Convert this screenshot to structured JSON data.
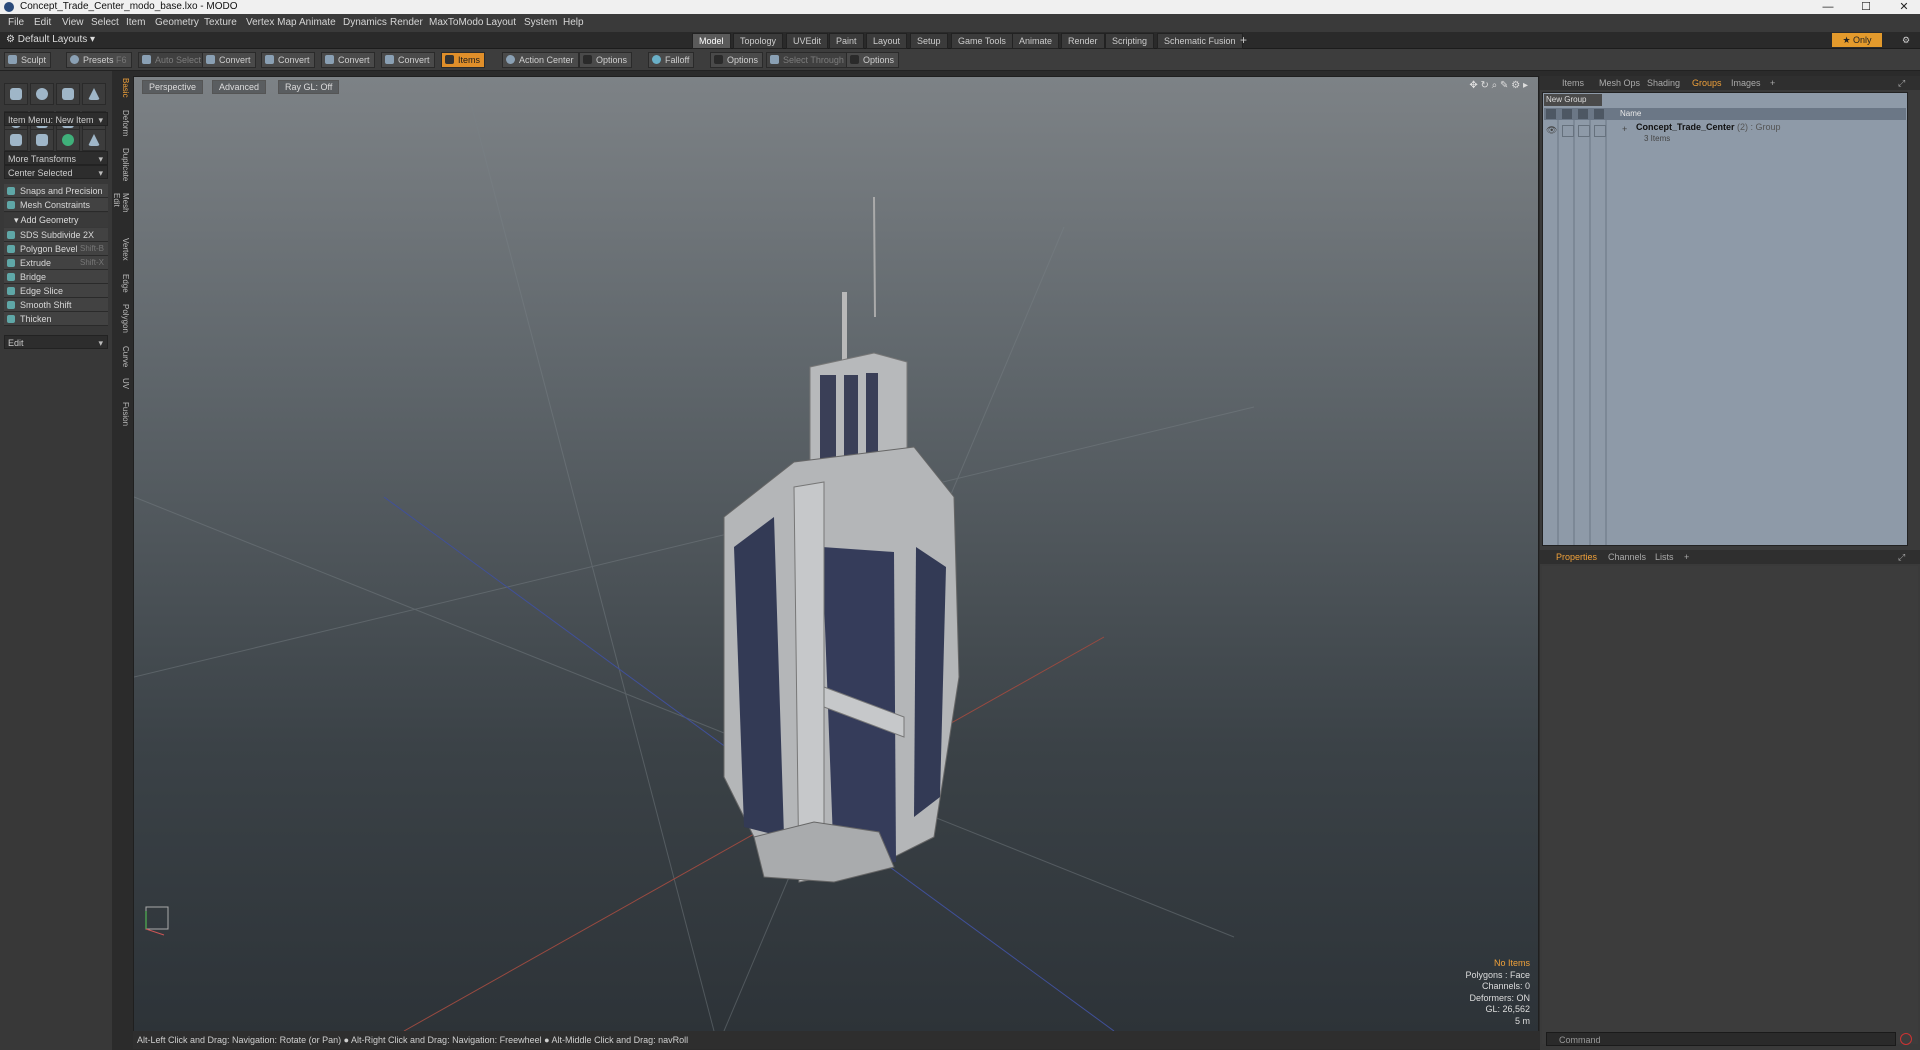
{
  "window": {
    "title": "Concept_Trade_Center_modo_base.lxo - MODO",
    "buttons": [
      "—",
      "☐",
      "✕"
    ]
  },
  "menu": [
    "File",
    "Edit",
    "View",
    "Select",
    "Item",
    "Geometry",
    "Texture",
    "Vertex Map",
    "Animate",
    "Dynamics",
    "Render",
    "MaxToModo",
    "Layout",
    "System",
    "Help"
  ],
  "layouts": {
    "default": "Default Layouts",
    "tabs": [
      "Model",
      "Topology",
      "UVEdit",
      "Paint",
      "Layout",
      "Setup",
      "Game Tools",
      "Animate",
      "Render",
      "Scripting",
      "Schematic Fusion",
      "+"
    ],
    "active_tab": "Model",
    "only_label": "★ Only"
  },
  "toolbar": {
    "sculpt": "Sculpt",
    "presets": "Presets",
    "presets_shortcut": "F6",
    "auto_select": "Auto Select",
    "convert1": "Convert",
    "convert2": "Convert",
    "convert3": "Convert",
    "convert4": "Convert",
    "items": "Items",
    "action_center": "Action Center",
    "options1": "Options",
    "falloff": "Falloff",
    "options2": "Options",
    "select_through": "Select Through",
    "options3": "Options"
  },
  "left": {
    "item_menu": "Item Menu: New Item",
    "more_transforms": "More Transforms",
    "center_selected": "Center Selected",
    "snaps": "Snaps and Precision",
    "mesh_constraints": "Mesh Constraints",
    "add_geometry": "Add Geometry",
    "tools": [
      {
        "label": "SDS Subdivide 2X",
        "shortcut": ""
      },
      {
        "label": "Polygon Bevel",
        "shortcut": "Shift-B"
      },
      {
        "label": "Extrude",
        "shortcut": "Shift-X"
      },
      {
        "label": "Bridge",
        "shortcut": ""
      },
      {
        "label": "Edge Slice",
        "shortcut": ""
      },
      {
        "label": "Smooth Shift",
        "shortcut": ""
      },
      {
        "label": "Thicken",
        "shortcut": ""
      }
    ],
    "edit": "Edit"
  },
  "vertical_tabs": [
    "Basic",
    "Deform",
    "Duplicate",
    "Mesh Edit",
    "Vertex",
    "Edge",
    "Polygon",
    "Curve",
    "UV",
    "Fusion"
  ],
  "viewport": {
    "perspective": "Perspective",
    "advanced": "Advanced",
    "raygl": "Ray GL: Off",
    "info": {
      "no_items": "No Items",
      "polygons": "Polygons : Face",
      "channels": "Channels: 0",
      "deformers": "Deformers: ON",
      "gl": "GL: 26,562",
      "scale": "5 m"
    }
  },
  "status": "Alt-Left Click and Drag: Navigation: Rotate (or Pan) ● Alt-Right Click and Drag: Navigation: Freewheel ● Alt-Middle Click and Drag: navRoll",
  "right": {
    "tabs": [
      "Items",
      "Mesh Ops",
      "Shading",
      "Groups",
      "Images",
      "+"
    ],
    "active_tab": "Groups",
    "new_group": "New Group",
    "name_header": "Name",
    "group_name": "Concept_Trade_Center",
    "group_suffix": " (2) : Group",
    "group_items": "3 Items",
    "prop_tabs": [
      "Properties",
      "Channels",
      "Lists",
      "+"
    ],
    "active_prop_tab": "Properties"
  },
  "command": {
    "placeholder": "Command"
  },
  "colors": {
    "accent": "#e39a2c"
  }
}
